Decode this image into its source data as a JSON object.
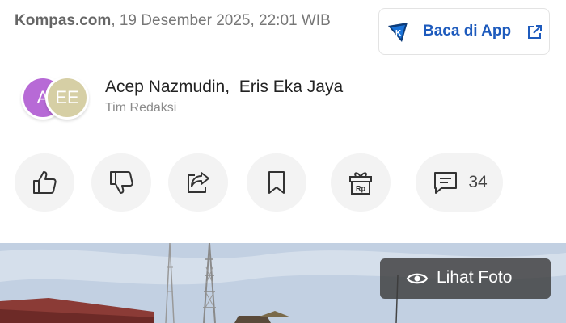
{
  "article": {
    "source": "Kompas.com",
    "datetime": ", 19 Desember 2025, 22:01 WIB"
  },
  "app_button": {
    "label": "Baca di App",
    "logo_letter": "K"
  },
  "authors": {
    "avatars": [
      "A",
      "EE"
    ],
    "names": "Acep Nazmudin,  Eris Eka Jaya",
    "team": "Tim Redaksi"
  },
  "actions": {
    "like_icon": "thumbs-up-icon",
    "dislike_icon": "thumbs-down-icon",
    "share_icon": "share-icon",
    "bookmark_icon": "bookmark-icon",
    "gift_icon": "gift-icon",
    "gift_text": "Rp",
    "comment_icon": "comment-icon",
    "comment_count": "34"
  },
  "photo": {
    "view_label": "Lihat Foto"
  },
  "colors": {
    "accent": "#1e5bbd",
    "avatar_a": "#b76ad6",
    "avatar_b": "#d6cfa5"
  }
}
